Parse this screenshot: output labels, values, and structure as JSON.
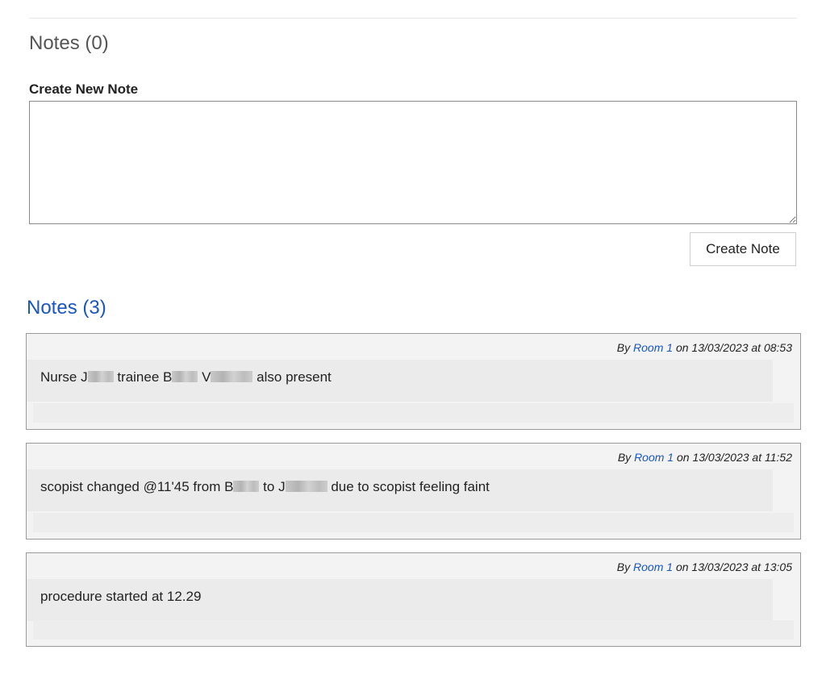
{
  "notes_empty_section": {
    "title": "Notes (0)",
    "create_label": "Create New Note",
    "textarea_value": "",
    "create_button_label": "Create Note"
  },
  "notes_section": {
    "title": "Notes (3)",
    "items": [
      {
        "by_label": "By",
        "author": "Room 1",
        "on_label": "on",
        "date": "13/03/2023",
        "at_label": "at",
        "time": "08:53",
        "text_parts": [
          "Nurse J",
          "trainee B",
          "V",
          "also present"
        ]
      },
      {
        "by_label": "By",
        "author": "Room 1",
        "on_label": "on",
        "date": "13/03/2023",
        "at_label": "at",
        "time": "11:52",
        "text_parts": [
          "scopist changed @11'45 from B",
          "to J",
          "due to scopist feeling faint"
        ]
      },
      {
        "by_label": "By",
        "author": "Room 1",
        "on_label": "on",
        "date": "13/03/2023",
        "at_label": "at",
        "time": "13:05",
        "text": "procedure started at 12.29"
      }
    ]
  },
  "colors": {
    "link_blue": "#1a56c0",
    "card_background": "#f3f3f3",
    "card_border": "#9a9a9a"
  }
}
